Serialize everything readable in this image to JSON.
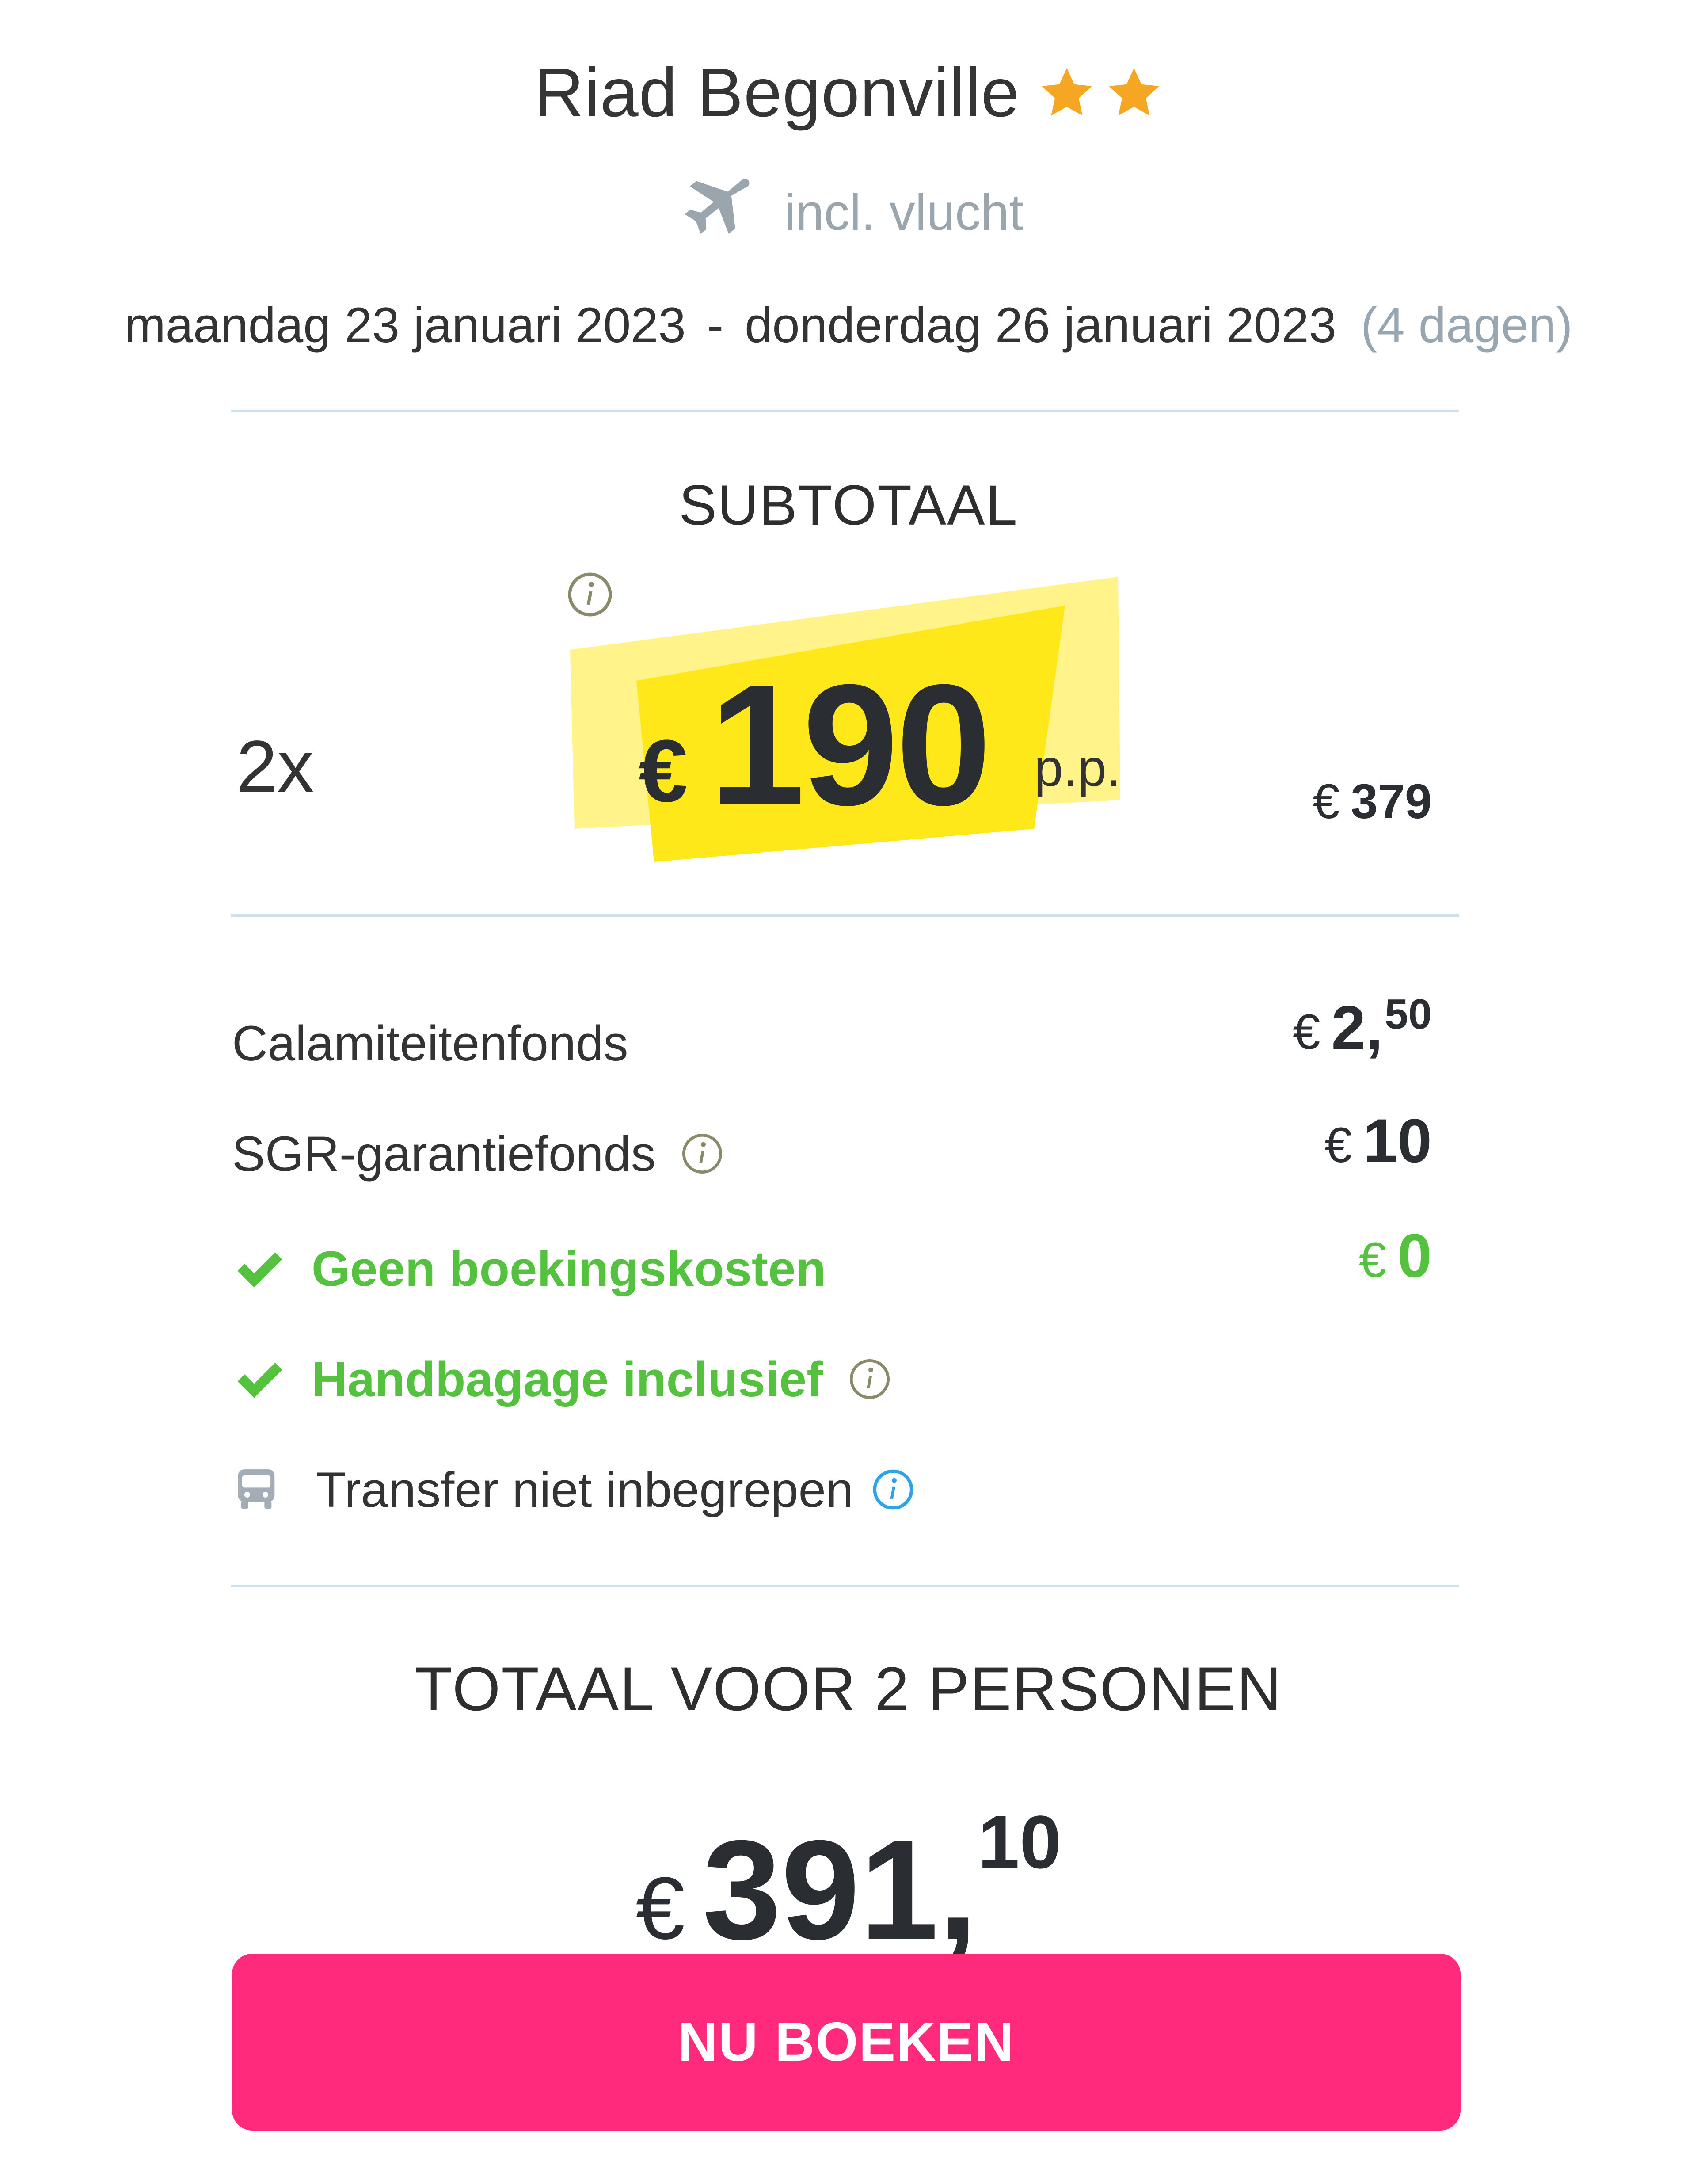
{
  "header": {
    "hotel_name": "Riad Begonville",
    "stars": 2,
    "flight_label": "incl. vlucht",
    "date_from": "maandag 23 januari 2023",
    "date_separator": "-",
    "date_to": "donderdag 26 januari 2023",
    "duration": "(4 dagen)"
  },
  "subtotal": {
    "label": "SUBTOTAAL",
    "quantity": "2x",
    "price_currency": "€",
    "price_per_person": "190",
    "per_person_label": "p.p.",
    "total_currency": "€",
    "total": "379"
  },
  "fees": [
    {
      "label": "Calamiteitenfonds",
      "currency": "€",
      "amount_main": "2,",
      "amount_sup": "50"
    },
    {
      "label": "SGR-garantiefonds",
      "currency": "€",
      "amount_main": "10"
    },
    {
      "label": "Geen boekingskosten",
      "currency": "€",
      "amount_main": "0"
    },
    {
      "label": "Handbagage inclusief"
    },
    {
      "label": "Transfer niet inbegrepen"
    }
  ],
  "total": {
    "label": "TOTAAL VOOR 2 PERSONEN",
    "currency": "€",
    "amount_main": "391,",
    "amount_sup": "10"
  },
  "book_button_label": "NU BOEKEN",
  "colors": {
    "accent": "#ff2a7c",
    "green": "#55c23f",
    "highlight": "#ffe81a",
    "star": "#f5a623",
    "divider": "#cfe0ee"
  }
}
